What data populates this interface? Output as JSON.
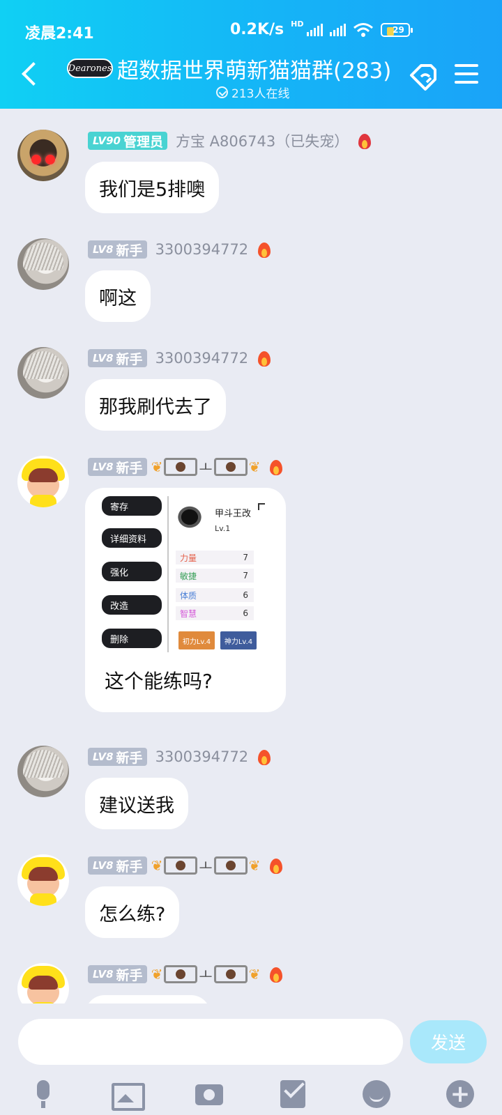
{
  "status": {
    "time": "凌晨2:41",
    "net_speed": "0.2K/s",
    "hd": "HD",
    "battery": "29"
  },
  "header": {
    "logo_text": "Dearones",
    "title": "超数据世界萌新猫猫群(283)",
    "online": "213人在线"
  },
  "messages": [
    {
      "level": "LV90",
      "role": "管理员",
      "sender": "方宝  A806743（已失宠）",
      "text": "我们是5排噢"
    },
    {
      "level": "LV8",
      "role": "新手",
      "sender": "3300394772",
      "text": "啊这"
    },
    {
      "level": "LV8",
      "role": "新手",
      "sender": "3300394772",
      "text": "那我刷代去了"
    },
    {
      "level": "LV8",
      "role": "新手",
      "sender_emoji": "ㅗ",
      "image": {
        "buttons": [
          "寄存",
          "详细资料",
          "强化",
          "改造",
          "删除"
        ],
        "item_name": "甲斗王改",
        "item_level": "Lv.1",
        "stats": [
          {
            "label": "力量",
            "value": "7",
            "color": "#e5604a"
          },
          {
            "label": "敏捷",
            "value": "7",
            "color": "#3aa05a"
          },
          {
            "label": "体质",
            "value": "6",
            "color": "#4a7fd6"
          },
          {
            "label": "智慧",
            "value": "6",
            "color": "#d45ad8"
          }
        ],
        "skills": [
          {
            "label": "初力Lv.4",
            "color": "#e08a3c"
          },
          {
            "label": "神力Lv.4",
            "color": "#3f5c9c"
          }
        ]
      },
      "text": "这个能练吗?"
    },
    {
      "level": "LV8",
      "role": "新手",
      "sender": "3300394772",
      "text": "建议送我"
    },
    {
      "level": "LV8",
      "role": "新手",
      "sender_emoji": "ㅗ",
      "text": "怎么练?"
    },
    {
      "level": "LV8",
      "role": "新手",
      "sender_emoji": "ㅗ",
      "text": ""
    }
  ],
  "input": {
    "value": "",
    "send_label": "发送"
  },
  "colors": {
    "header_start": "#10d0f4",
    "header_end": "#1aa3f8",
    "admin_badge": "#49d3d2",
    "newbie_badge": "#b4bccd",
    "send_button": "#a9e8fb"
  }
}
